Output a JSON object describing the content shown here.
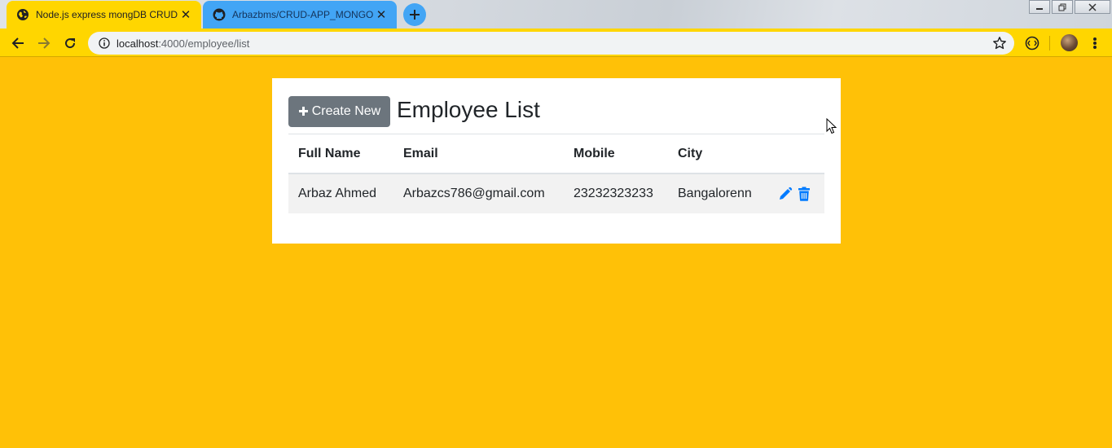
{
  "browser": {
    "tabs": [
      {
        "title": "Node.js express mongDB CRUD",
        "icon": "globe-icon",
        "active": true
      },
      {
        "title": "Arbazbms/CRUD-APP_MONGODB",
        "icon": "github-icon",
        "active": false
      }
    ],
    "close_glyph": "✕",
    "address": {
      "host": "localhost",
      "rest": ":4000/employee/list"
    }
  },
  "page": {
    "create_button_label": "Create New",
    "create_button_icon": "plus-icon",
    "title": "Employee List",
    "table": {
      "headers": [
        "Full Name",
        "Email",
        "Mobile",
        "City",
        ""
      ],
      "rows": [
        {
          "full_name": "Arbaz Ahmed",
          "email": "Arbazcs786@gmail.com",
          "mobile": "23232323233",
          "city": "Bangalorenn",
          "actions": [
            "edit-icon",
            "delete-icon"
          ]
        }
      ]
    }
  },
  "colors": {
    "page_background": "#ffc107",
    "button_secondary": "#6c757d",
    "action_icon": "#007bff",
    "active_tab": "#ffd600",
    "inactive_tab": "#42a5f5"
  }
}
